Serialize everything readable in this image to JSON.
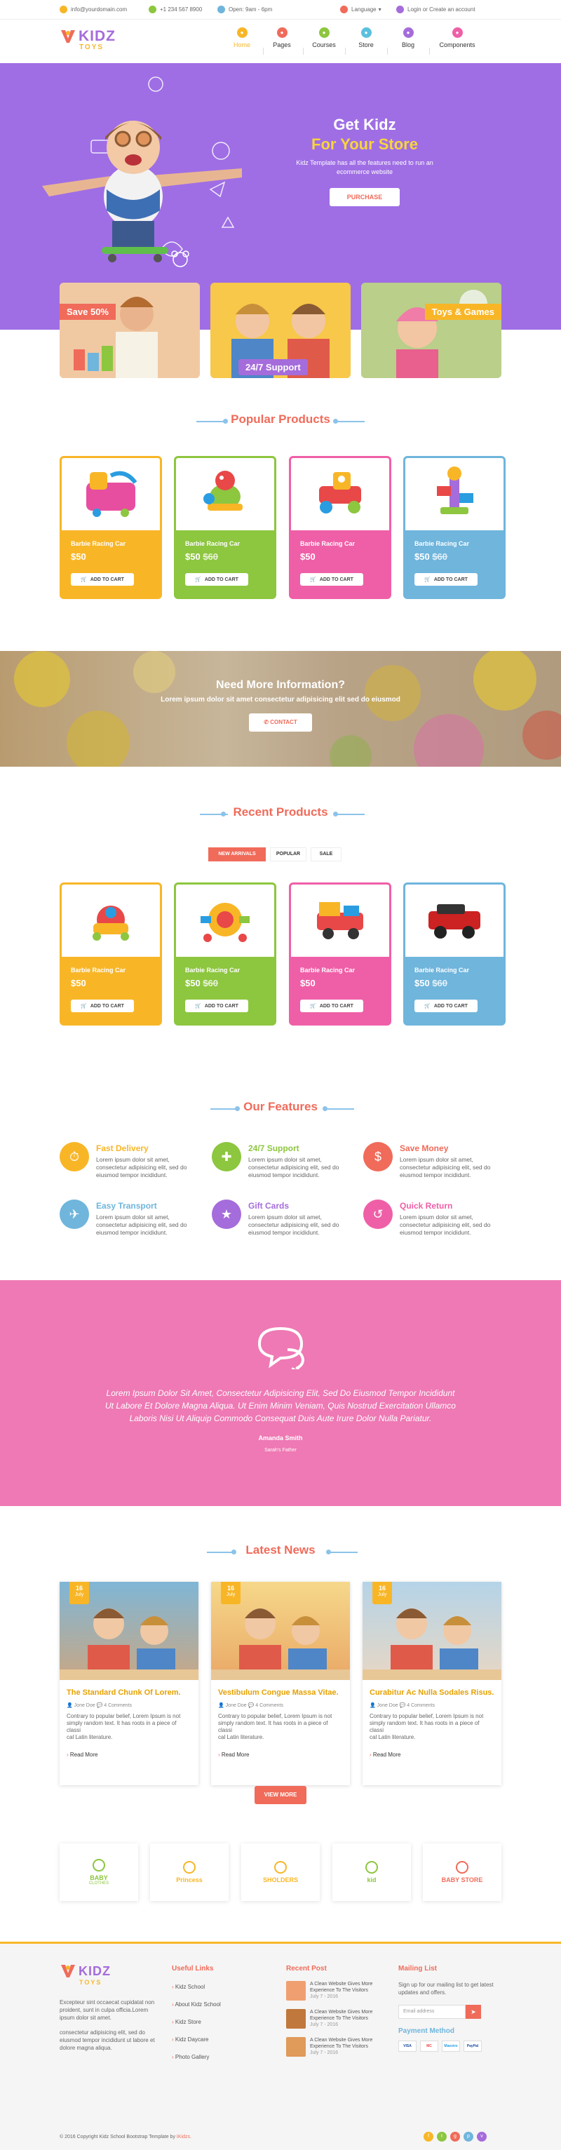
{
  "topbar": {
    "email": "info@yourdomain.com",
    "phone": "+1 234 567 8900",
    "hours": "Open: 9am - 6pm",
    "language": "Language",
    "login": "Login",
    "or": "or",
    "create": "Create an account"
  },
  "logo": {
    "line1": "KIDZ",
    "line2": "TOYS"
  },
  "nav": [
    {
      "label": "Home",
      "color": "#f8b627",
      "icon": "home-icon"
    },
    {
      "label": "Pages",
      "color": "#f06b5a",
      "icon": "pages-icon"
    },
    {
      "label": "Courses",
      "color": "#8dc63f",
      "icon": "courses-icon"
    },
    {
      "label": "Store",
      "color": "#5bc0de",
      "icon": "store-icon"
    },
    {
      "label": "Blog",
      "color": "#a56cdb",
      "icon": "blog-icon"
    },
    {
      "label": "Components",
      "color": "#ef5fa7",
      "icon": "components-icon"
    }
  ],
  "hero": {
    "title1": "Get Kidz",
    "title2": "For Your Store",
    "desc1": "Kidz Template has all the features need to run an",
    "desc2": "ecommerce website",
    "button": "PURCHASE"
  },
  "promo": {
    "save": "Save 50%",
    "support": "24/7 Support",
    "toys": "Toys & Games"
  },
  "popular": {
    "title": "Popular Products",
    "products": [
      {
        "name": "Barbie Racing Car",
        "price": "$50",
        "old": "",
        "color": "#f8b627",
        "cart": "ADD TO CART"
      },
      {
        "name": "Barbie Racing Car",
        "price": "$50",
        "old": "$60",
        "color": "#8dc63f",
        "cart": "ADD TO CART"
      },
      {
        "name": "Barbie Racing Car",
        "price": "$50",
        "old": "",
        "color": "#ef5fa7",
        "cart": "ADD TO CART"
      },
      {
        "name": "Barbie Racing Car",
        "price": "$50",
        "old": "$60",
        "color": "#6fb5dc",
        "cart": "ADD TO CART"
      }
    ]
  },
  "info": {
    "title": "Need More Information?",
    "desc": "Lorem ipsum dolor sit amet consectetur adipisicing elit sed do eiusmod",
    "button": "CONTACT"
  },
  "recent": {
    "title": "Recent Products",
    "tabs": [
      "NEW ARRIVALS",
      "POPULAR",
      "SALE"
    ],
    "products": [
      {
        "name": "Barbie Racing Car",
        "price": "$50",
        "old": "",
        "color": "#f8b627",
        "cart": "ADD TO CART"
      },
      {
        "name": "Barbie Racing Car",
        "price": "$50",
        "old": "$60",
        "color": "#8dc63f",
        "cart": "ADD TO CART"
      },
      {
        "name": "Barbie Racing Car",
        "price": "$50",
        "old": "",
        "color": "#ef5fa7",
        "cart": "ADD TO CART"
      },
      {
        "name": "Barbie Racing Car",
        "price": "$50",
        "old": "$60",
        "color": "#6fb5dc",
        "cart": "ADD TO CART"
      }
    ]
  },
  "features": {
    "title": "Our Features",
    "items": [
      {
        "title": "Fast Delivery",
        "color": "#f8b627",
        "icon": "delivery-icon",
        "d1": "Lorem ipsum dolor sit amet,",
        "d2": "consectetur adipisicing elit, sed do",
        "d3": "eiusmod tempor incididunt."
      },
      {
        "title": "24/7 Support",
        "color": "#8dc63f",
        "icon": "support-icon",
        "d1": "Lorem ipsum dolor sit amet,",
        "d2": "consectetur adipisicing elit, sed do",
        "d3": "eiusmod tempor incididunt."
      },
      {
        "title": "Save Money",
        "color": "#f06b5a",
        "icon": "money-icon",
        "d1": "Lorem ipsum dolor sit amet,",
        "d2": "consectetur adipisicing elit, sed do",
        "d3": "eiusmod tempor incididunt."
      },
      {
        "title": "Easy Transport",
        "color": "#6fb5dc",
        "icon": "transport-icon",
        "d1": "Lorem ipsum dolor sit amet,",
        "d2": "consectetur adipisicing elit, sed do",
        "d3": "eiusmod tempor incididunt."
      },
      {
        "title": "Gift Cards",
        "color": "#a56cdb",
        "icon": "gift-icon",
        "d1": "Lorem ipsum dolor sit amet,",
        "d2": "consectetur adipisicing elit, sed do",
        "d3": "eiusmod tempor incididunt."
      },
      {
        "title": "Quick Return",
        "color": "#ef5fa7",
        "icon": "return-icon",
        "d1": "Lorem ipsum dolor sit amet,",
        "d2": "consectetur adipisicing elit, sed do",
        "d3": "eiusmod tempor incididunt."
      }
    ]
  },
  "testimonial": {
    "l1": "Lorem Ipsum Dolor Sit Amet, Consectetur Adipisicing Elit, Sed Do Eiusmod Tempor Incididunt",
    "l2": "Ut Labore Et Dolore Magna Aliqua. Ut Enim Minim Veniam, Quis Nostrud Exercitation Ullamco",
    "l3": "Laboris Nisi Ut Aliquip Commodo Consequat Duis Aute Irure Dolor Nulla Pariatur.",
    "name": "Amanda Smith",
    "role": "Sarah's Father"
  },
  "news": {
    "title": "Latest News",
    "button": "VIEW MORE",
    "items": [
      {
        "day": "16",
        "month": "July",
        "title": "The Standard Chunk Of Lorem.",
        "author": "Jone Doe",
        "comments": "4 Comments",
        "d1": "Contrary to popular belief, Lorem Ipsum is not",
        "d2": "simply random text. It has roots in a piece of classi",
        "d3": "cal Latin literature.",
        "more": "Read More"
      },
      {
        "day": "16",
        "month": "July",
        "title": "Vestibulum Congue Massa Vitae.",
        "author": "Jone Doe",
        "comments": "4 Comments",
        "d1": "Contrary to popular belief, Lorem Ipsum is not",
        "d2": "simply random text. It has roots in a piece of classi",
        "d3": "cal Latin literature.",
        "more": "Read More"
      },
      {
        "day": "16",
        "month": "July",
        "title": "Curabitur Ac Nulla Sodales Risus.",
        "author": "Jone Doe",
        "comments": "4 Comments",
        "d1": "Contrary to popular belief, Lorem Ipsum is not",
        "d2": "simply random text. It has roots in a piece of classi",
        "d3": "cal Latin literature.",
        "more": "Read More"
      }
    ]
  },
  "brands": [
    {
      "l1": "BABY",
      "l2": "CLOTHES",
      "color": "#8dc63f"
    },
    {
      "l1": "Princess",
      "l2": "",
      "color": "#f8b627"
    },
    {
      "l1": "SHOLDERS",
      "l2": "",
      "color": "#f8b627"
    },
    {
      "l1": "kid",
      "l2": "",
      "color": "#8dc63f"
    },
    {
      "l1": "BABY STORE",
      "l2": "",
      "color": "#f06b5a"
    }
  ],
  "footer": {
    "about1": "Excepteur sint occaecat cupidatat non",
    "about2": "proident, sunt in culpa officia.Lorem",
    "about3": "ipsum dolor sit amet.",
    "about4": "consectetur adipisicing elit, sed do",
    "about5": "eiusmod tempor incididunt ut labore et",
    "about6": "dolore magna aliqua.",
    "links_title": "Useful Links",
    "links": [
      "Kidz School",
      "About Kidz School",
      "Kidz Store",
      "Kidz Daycare",
      "Photo Gallery"
    ],
    "recent_title": "Recent Post",
    "posts": [
      {
        "t1": "A Clean Website Gives More",
        "t2": "Experience To The Visitors",
        "date": "July 7 - 2016"
      },
      {
        "t1": "A Clean Website Gives More",
        "t2": "Experience To The Visitors",
        "date": "July 7 - 2016"
      },
      {
        "t1": "A Clean Website Gives More",
        "t2": "Experience To The Visitors",
        "date": "July 7 - 2016"
      }
    ],
    "mail_title": "Mailing List",
    "mail1": "Sign up for our mailing list to get latest",
    "mail2": "updates and offers.",
    "mail_placeholder": "Email address",
    "pay_title": "Payment Method",
    "pay": [
      "VISA",
      "MC",
      "Maestro",
      "PayPal"
    ],
    "copy": "© 2016 Copyright Kidz School Bootstrap Template by",
    "copy_brand": "IKidzs."
  }
}
